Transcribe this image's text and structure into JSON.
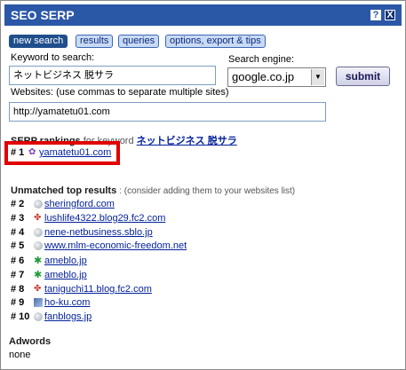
{
  "window": {
    "title": "SEO SERP",
    "help_label": "?",
    "close_label": "X"
  },
  "tabs": [
    {
      "label": "new search",
      "active": true
    },
    {
      "label": "results"
    },
    {
      "label": "queries"
    },
    {
      "label": "options, export & tips"
    }
  ],
  "form": {
    "keyword_label": "Keyword to search:",
    "keyword_value": "ネットビジネス 脱サラ",
    "engine_label": "Search engine:",
    "engine_value": "google.co.jp",
    "submit_label": "submit",
    "websites_label": "Websites: (use commas to separate multiple sites)",
    "websites_value": "http://yamatetu01.com"
  },
  "rankings": {
    "title": "SERP rankings",
    "for_keyword": "for keyword",
    "keyword": "ネットビジネス 脱サラ",
    "items": [
      {
        "rank": "# 1",
        "site": "yamatetu01.com",
        "icon": "purple-flower-icon"
      }
    ]
  },
  "unmatched": {
    "title": "Unmatched top results",
    "hint": ": (consider adding them to your websites list)",
    "items": [
      {
        "rank": "# 2",
        "site": "sheringford.com",
        "icon": "globe-icon"
      },
      {
        "rank": "# 3",
        "site": "lushlife4322.blog29.fc2.com",
        "icon": "fc2-icon"
      },
      {
        "rank": "# 4",
        "site": "nene-netbusiness.sblo.jp",
        "icon": "globe-icon"
      },
      {
        "rank": "# 5",
        "site": "www.mlm-economic-freedom.net",
        "icon": "globe-icon"
      },
      {
        "rank": "# 6",
        "site": "ameblo.jp",
        "icon": "ameba-icon"
      },
      {
        "rank": "# 7",
        "site": "ameblo.jp",
        "icon": "ameba-icon"
      },
      {
        "rank": "# 8",
        "site": "taniguchi11.blog.fc2.com",
        "icon": "fc2-icon"
      },
      {
        "rank": "# 9",
        "site": "ho-ku.com",
        "icon": "thumbnail-icon"
      },
      {
        "rank": "# 10",
        "site": "fanblogs.jp",
        "icon": "globe-icon"
      }
    ]
  },
  "adwords": {
    "title": "Adwords",
    "value": "none"
  }
}
